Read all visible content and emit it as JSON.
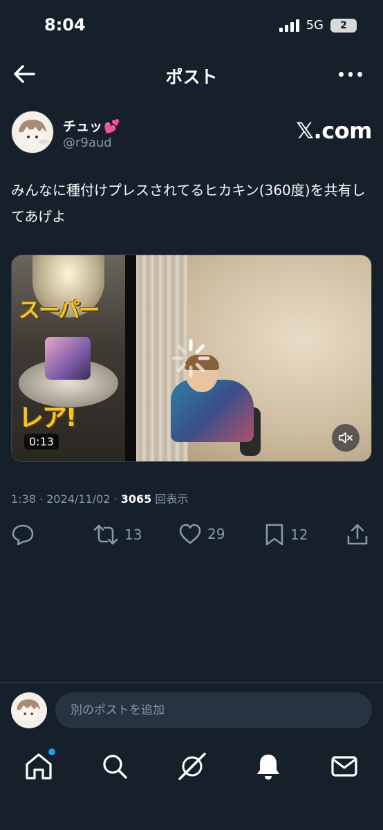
{
  "status": {
    "time": "8:04",
    "network": "5G",
    "battery": "2"
  },
  "header": {
    "title": "ポスト"
  },
  "author": {
    "name": "チュッ",
    "emoji": "💕",
    "handle": "@r9aud",
    "watermark": "𝕏.com"
  },
  "post": {
    "text": "みんなに種付けプレスされてるヒカキン(360度)を共有してあげよ",
    "media": {
      "overlay_top": "スーパー",
      "overlay_bottom": "レア!",
      "duration": "0:13"
    },
    "time": "1:38",
    "date": "2024/11/02",
    "views": "3065",
    "views_suffix": "回表示"
  },
  "actions": {
    "reposts": "13",
    "likes": "29",
    "bookmarks": "12"
  },
  "reply": {
    "placeholder": "別のポストを追加"
  },
  "colors": {
    "background": "#15202b",
    "muted": "#8b98a5",
    "accent": "#1d9bf0"
  }
}
